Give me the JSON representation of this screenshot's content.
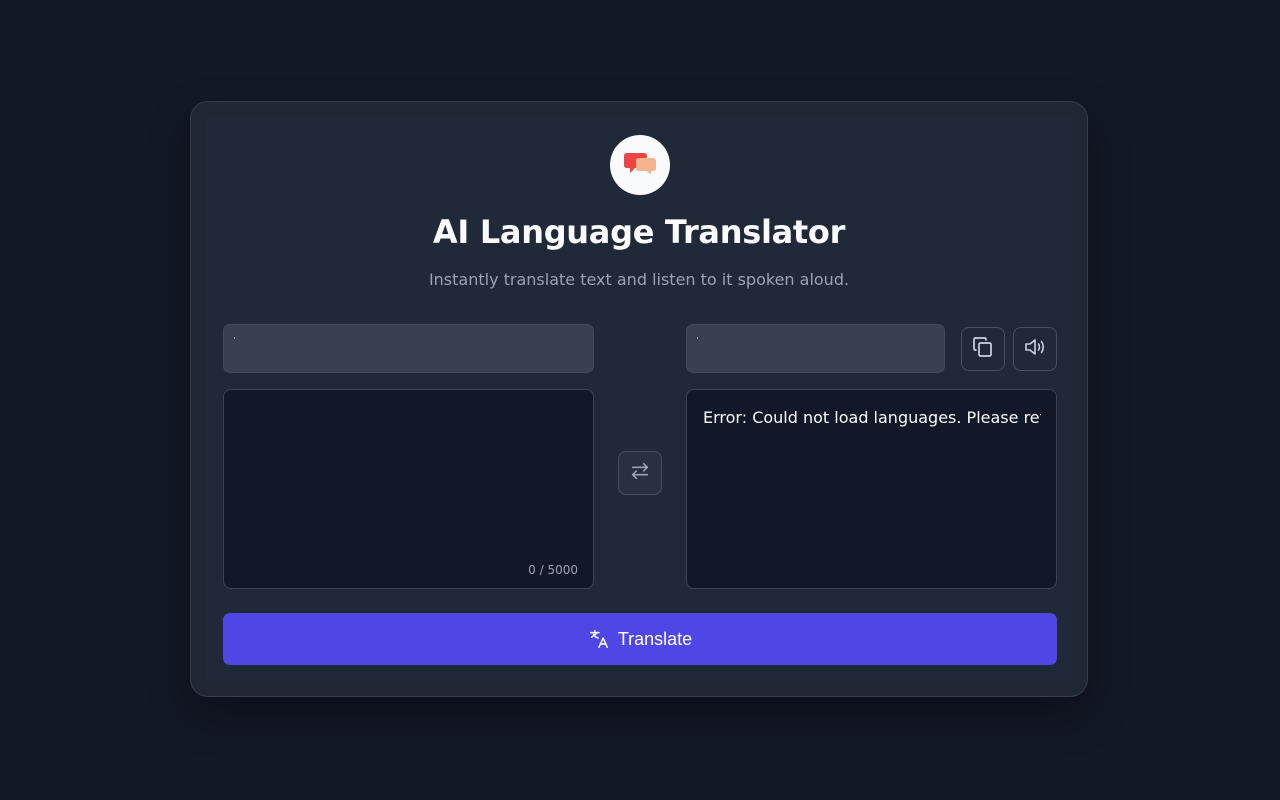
{
  "app": {
    "title": "AI Language Translator",
    "subtitle": "Instantly translate text and listen to it spoken aloud."
  },
  "icons": {
    "logo": "chat-bubbles-icon",
    "copy": "copy-icon",
    "speak": "speaker-icon",
    "swap": "swap-arrows-icon",
    "translate": "translate-icon"
  },
  "source": {
    "language_value": "",
    "text_value": "",
    "char_count": "0 / 5000"
  },
  "target": {
    "language_value": "",
    "output_text": "Error: Could not load languages. Please ref"
  },
  "actions": {
    "translate_label": "Translate"
  },
  "colors": {
    "background": "#121826",
    "card": "#1f2937",
    "input": "#111827",
    "select": "#374151",
    "accent": "#4f46e5",
    "logo_red": "#ef4444",
    "logo_peach": "#f4b48e"
  }
}
